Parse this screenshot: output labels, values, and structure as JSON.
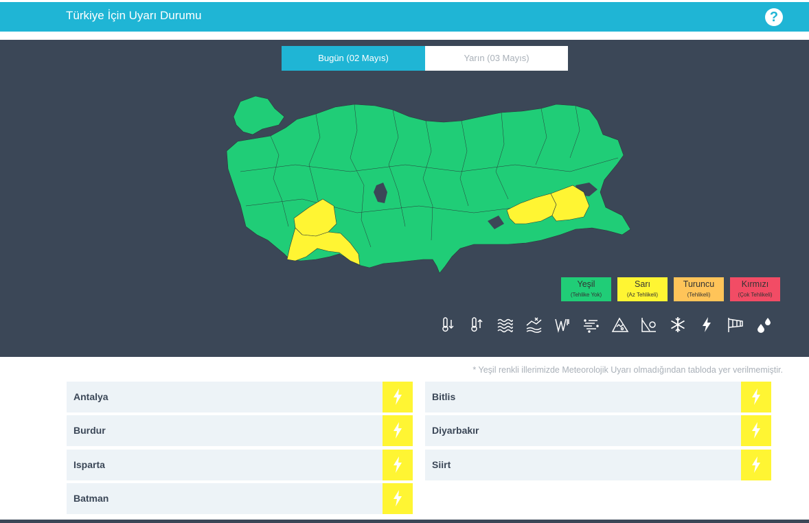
{
  "header": {
    "title": "Türkiye İçin Uyarı Durumu",
    "help": "?"
  },
  "tabs": [
    {
      "label": "Bugün (02 Mayıs)",
      "active": true
    },
    {
      "label": "Yarın (03 Mayıs)",
      "active": false
    }
  ],
  "legend": [
    {
      "name": "Yeşil",
      "sub": "(Tehlike Yok)",
      "color": "#20cd77"
    },
    {
      "name": "Sarı",
      "sub": "(Az Tehlikeli)",
      "color": "#fff533"
    },
    {
      "name": "Turuncu",
      "sub": "(Tehlikeli)",
      "color": "#ffc459"
    },
    {
      "name": "Kırmızı",
      "sub": "(Çok Tehlikeli)",
      "color": "#f24c65"
    }
  ],
  "weather_icons": [
    "low-temperature-icon",
    "high-temperature-icon",
    "fog-icon",
    "snow-melt-icon",
    "wind-icon",
    "dust-icon",
    "avalanche-icon",
    "frost-icon",
    "snow-icon",
    "thunderstorm-icon",
    "strong-wind-icon",
    "rain-icon"
  ],
  "note": "* Yeşil renkli illerimizde Meteorolojik Uyarı olmadığından tabloda yer verilmemiştir.",
  "warnings_left": [
    {
      "province": "Antalya",
      "icon": "thunderstorm-icon"
    },
    {
      "province": "Burdur",
      "icon": "thunderstorm-icon"
    },
    {
      "province": "Isparta",
      "icon": "thunderstorm-icon"
    },
    {
      "province": "Batman",
      "icon": "thunderstorm-icon"
    }
  ],
  "warnings_right": [
    {
      "province": "Bitlis",
      "icon": "thunderstorm-icon"
    },
    {
      "province": "Diyarbakır",
      "icon": "thunderstorm-icon"
    },
    {
      "province": "Siirt",
      "icon": "thunderstorm-icon"
    }
  ],
  "colors": {
    "accent": "#1fb5d5",
    "panel": "#3b4757",
    "safe": "#20cd77",
    "warning": "#fff533"
  }
}
